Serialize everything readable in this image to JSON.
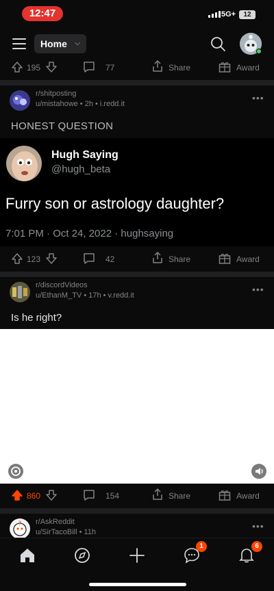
{
  "status_bar": {
    "time": "12:47",
    "network": "5G+",
    "battery": "12"
  },
  "header": {
    "feed_selector": "Home"
  },
  "posts": [
    {
      "actions": {
        "score": "195",
        "comments": "77",
        "share": "Share",
        "award": "Award"
      }
    },
    {
      "subreddit": "r/shitposting",
      "meta": "u/mistahowe • 2h • i.redd.it",
      "title": "HONEST QUESTION",
      "tweet": {
        "name": "Hugh Saying",
        "handle": "@hugh_beta",
        "text": "Furry son or astrology daughter?",
        "meta": "7:01 PM · Oct 24, 2022 · hughsaying"
      },
      "actions": {
        "score": "123",
        "comments": "42",
        "share": "Share",
        "award": "Award"
      }
    },
    {
      "subreddit": "r/discordVideos",
      "meta": "u/EthanM_TV • 17h • v.redd.it",
      "title": "Is he right?",
      "actions": {
        "score": "860",
        "comments": "154",
        "share": "Share",
        "award": "Award"
      }
    },
    {
      "subreddit": "r/AskReddit",
      "meta": "u/SirTacoBill • 11h"
    }
  ],
  "bottom_nav": {
    "chat_badge": "1",
    "inbox_badge": "6"
  },
  "colors": {
    "upvoted": "#ff4500",
    "muted": "#818384",
    "background": "#0b0b0b"
  }
}
